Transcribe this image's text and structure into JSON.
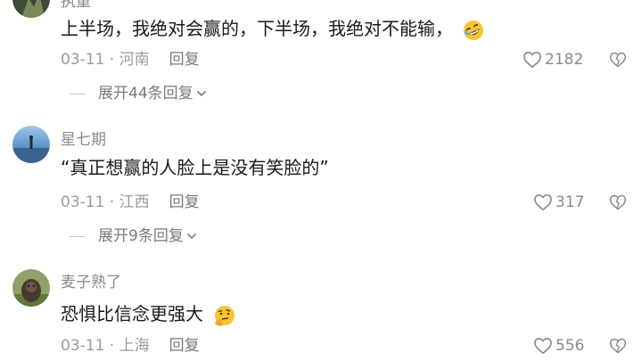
{
  "comments": [
    {
      "username": "执童",
      "text": "上半场，我绝对会赢的，下半场，我绝对不能输，",
      "date": "03-11",
      "location": "河南",
      "reply_label": "回复",
      "likes": "2182",
      "emoji": "rofl-emoji",
      "expand_label": "展开44条回复"
    },
    {
      "username": "星七期",
      "text": "“真正想赢的人脸上是没有笑脸的”",
      "date": "03-11",
      "location": "江西",
      "reply_label": "回复",
      "likes": "317",
      "expand_label": "展开9条回复"
    },
    {
      "username": "麦子熟了",
      "text": "恐惧比信念更强大",
      "date": "03-11",
      "location": "上海",
      "reply_label": "回复",
      "likes": "556",
      "emoji": "thinking-emoji"
    }
  ],
  "meta_separator": " · ",
  "colors": {
    "text": "#1a1a1a",
    "muted": "#9a9a9a",
    "emoji": "#f7c533"
  }
}
